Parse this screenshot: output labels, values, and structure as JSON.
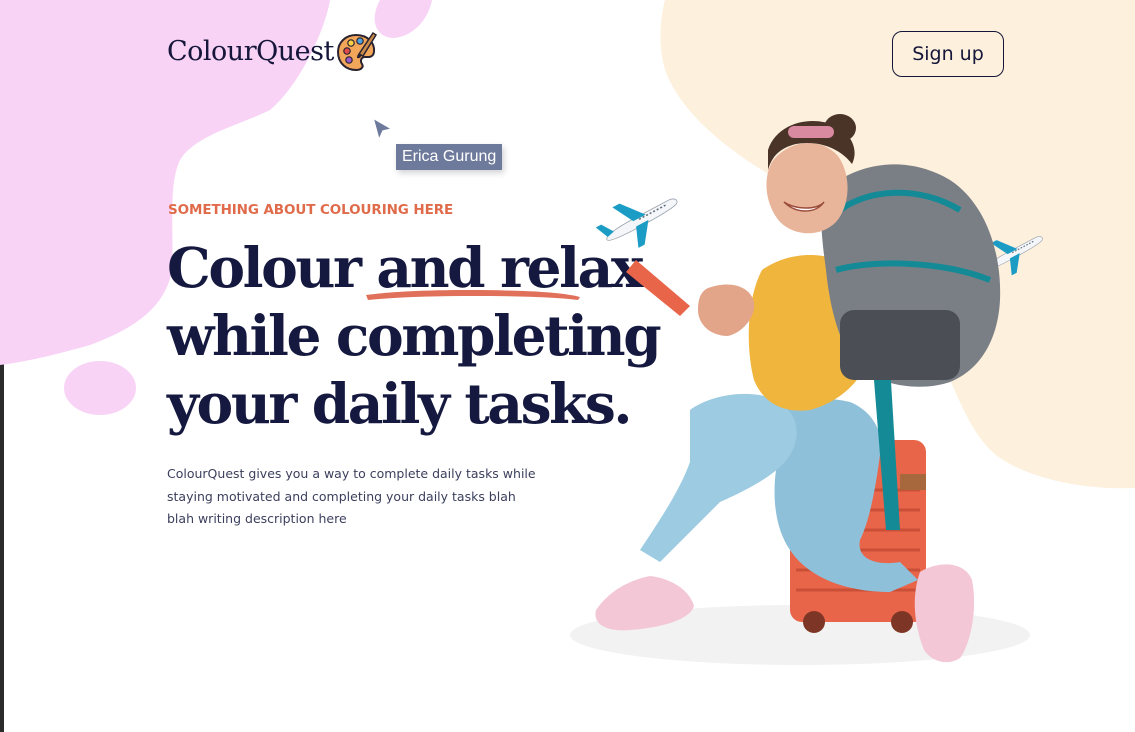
{
  "brand": {
    "name": "ColourQuest",
    "logo_icon": "palette-icon"
  },
  "header": {
    "signup_label": "Sign up"
  },
  "collaborator": {
    "name": "Erica Gurung",
    "cursor_icon": "cursor-arrow-icon"
  },
  "hero": {
    "eyebrow": "SOMETHING ABOUT COLOURING HERE",
    "headline_lines": [
      "Colour and relax",
      "while completing",
      "your daily tasks."
    ],
    "description": "ColourQuest gives you a way to complete daily tasks while staying motivated and completing your daily tasks blah blah writing description here"
  },
  "colors": {
    "navy": "#16193f",
    "coral": "#e06b4b",
    "pink_blob": "#f8d3f6",
    "peach_blob": "#fdf0dc",
    "tag_bg": "#6e7a9b"
  },
  "illustration": {
    "hero_image": "traveler-on-suitcase-illustration",
    "plane_icon": "airplane-icon"
  }
}
